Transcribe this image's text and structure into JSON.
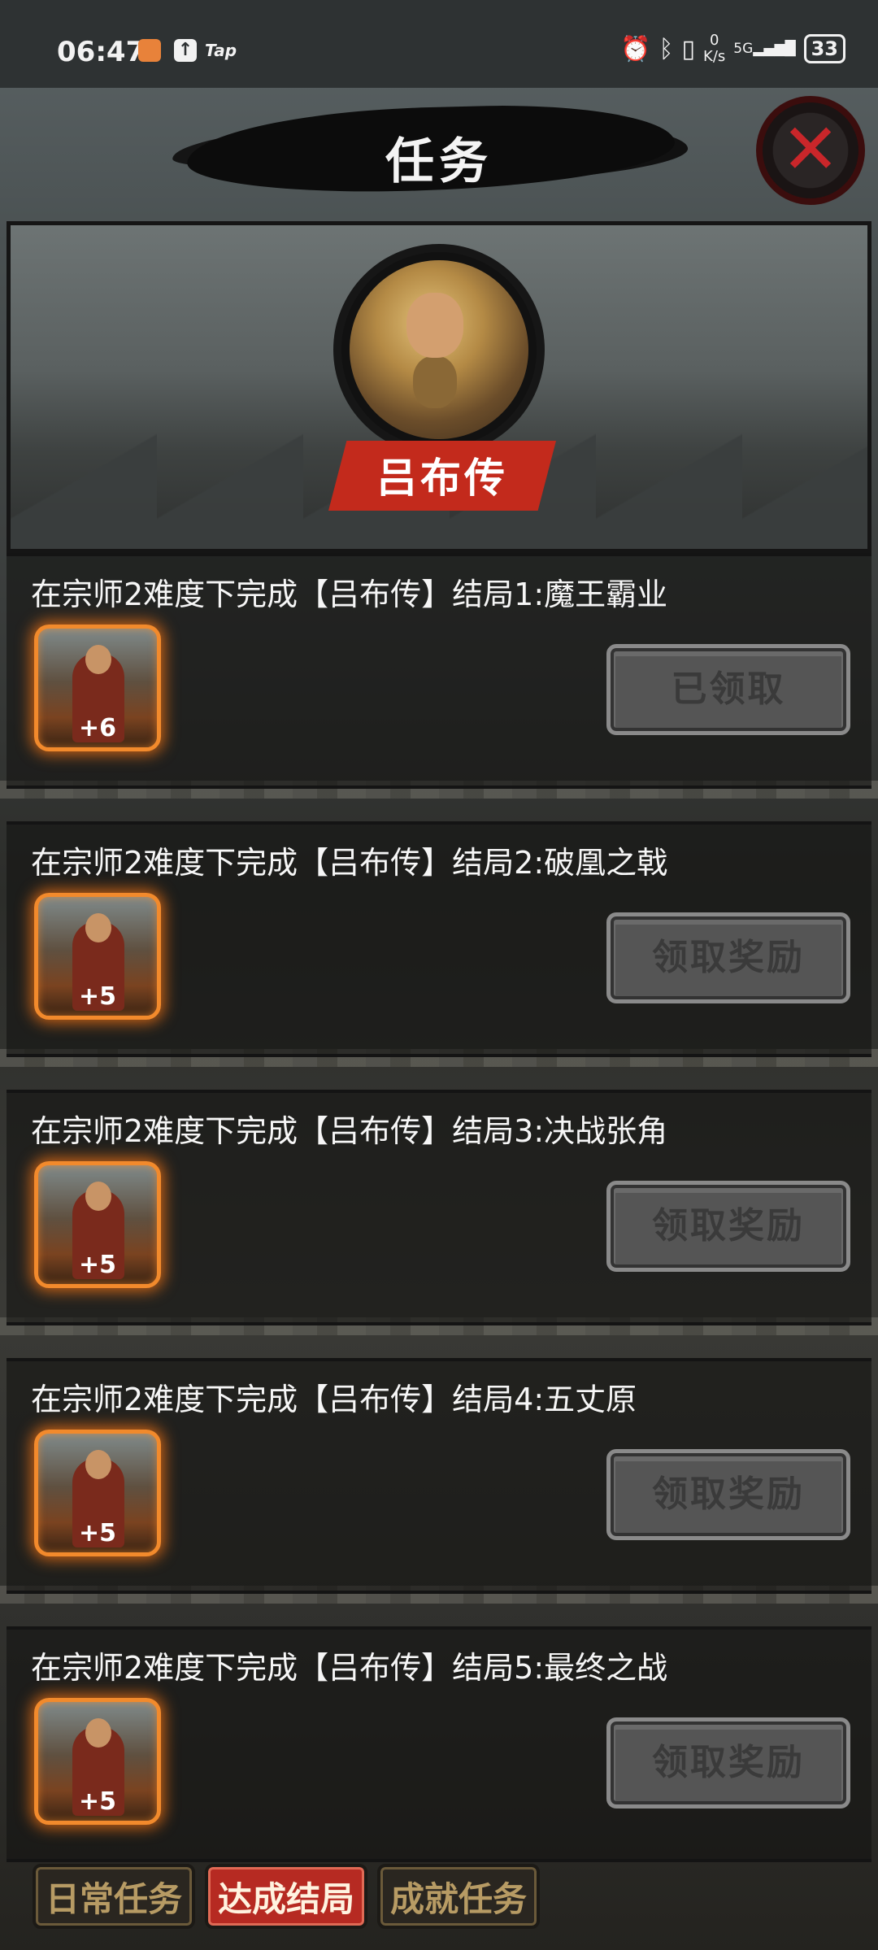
{
  "status_bar": {
    "time": "06:47",
    "app_label": "Tap",
    "net_speed_value": "0",
    "net_speed_unit": "K/s",
    "signal_label": "5G",
    "battery": "33"
  },
  "header": {
    "title": "任务",
    "close_icon": "close-x-icon"
  },
  "hero": {
    "name": "吕布传"
  },
  "quests": [
    {
      "text": "在宗师2难度下完成【吕布传】结局1:魔王霸业",
      "reward_count": "+6",
      "button": "已领取"
    },
    {
      "text": "在宗师2难度下完成【吕布传】结局2:破凰之戟",
      "reward_count": "+5",
      "button": "领取奖励"
    },
    {
      "text": "在宗师2难度下完成【吕布传】结局3:决战张角",
      "reward_count": "+5",
      "button": "领取奖励"
    },
    {
      "text": "在宗师2难度下完成【吕布传】结局4:五丈原",
      "reward_count": "+5",
      "button": "领取奖励"
    },
    {
      "text": "在宗师2难度下完成【吕布传】结局5:最终之战",
      "reward_count": "+5",
      "button": "领取奖励"
    }
  ],
  "tabs": [
    {
      "label": "日常任务",
      "active": false
    },
    {
      "label": "达成结局",
      "active": true
    },
    {
      "label": "成就任务",
      "active": false
    }
  ],
  "colors": {
    "accent_red": "#c32a1c",
    "reward_glow": "#f28a2c",
    "button_disabled": "#555555"
  }
}
